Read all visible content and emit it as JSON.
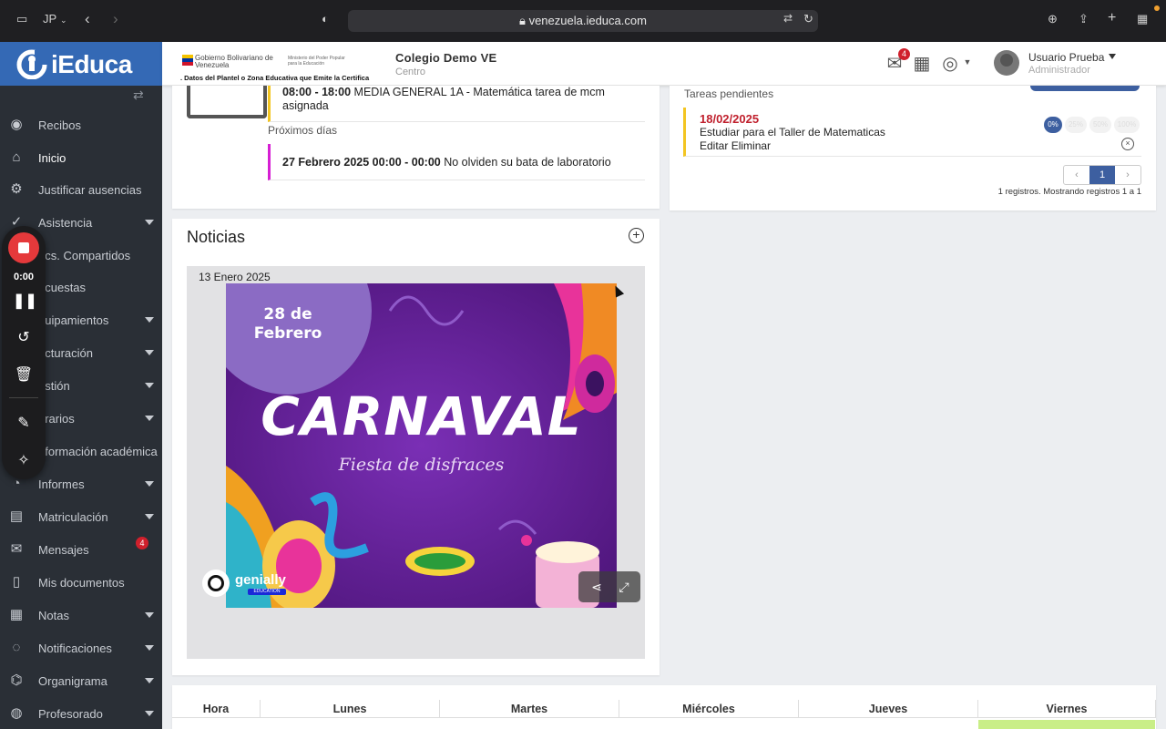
{
  "browser": {
    "profile": "JP",
    "url": "venezuela.ieduca.com"
  },
  "sidebar": {
    "brand": "iEduca",
    "items": [
      {
        "label": "Recibos",
        "icon": "coins-icon",
        "caret": false
      },
      {
        "label": "Inicio",
        "icon": "home-icon",
        "caret": false,
        "active": true
      },
      {
        "label": "Justificar ausencias",
        "icon": "gear-icon",
        "caret": false
      },
      {
        "label": "Asistencia",
        "icon": "check-circle-icon",
        "caret": true
      },
      {
        "label": "ocs. Compartidos",
        "icon": "folder-icon",
        "caret": false
      },
      {
        "label": "ncuestas",
        "icon": "poll-icon",
        "caret": false
      },
      {
        "label": "quipamientos",
        "icon": "box-icon",
        "caret": true
      },
      {
        "label": "acturación",
        "icon": "invoice-icon",
        "caret": true
      },
      {
        "label": "estión",
        "icon": "briefcase-icon",
        "caret": true
      },
      {
        "label": "orarios",
        "icon": "clock-icon",
        "caret": true
      },
      {
        "label": "nformación académica",
        "icon": "graduation-icon",
        "caret": false
      },
      {
        "label": "Informes",
        "icon": "pie-chart-icon",
        "caret": true
      },
      {
        "label": "Matriculación",
        "icon": "id-card-icon",
        "caret": true
      },
      {
        "label": "Mensajes",
        "icon": "envelope-icon",
        "caret": false,
        "badge": "4"
      },
      {
        "label": "Mis documentos",
        "icon": "document-icon",
        "caret": false
      },
      {
        "label": "Notas",
        "icon": "grid-icon",
        "caret": true
      },
      {
        "label": "Notificaciones",
        "icon": "chat-icon",
        "caret": true
      },
      {
        "label": "Organigrama",
        "icon": "sitemap-icon",
        "caret": true
      },
      {
        "label": "Profesorado",
        "icon": "user-icon",
        "caret": true
      }
    ]
  },
  "recorder": {
    "time": "0:00"
  },
  "header": {
    "gov_line1": "Gobierno Bolivariano de Venezuela",
    "gov_line2": "Ministerio del Poder Popular para la Educación",
    "gov_line3": ". Datos del Plantel o Zona Educativa que Emite la Certifica",
    "school_name": "Colegio Demo VE",
    "school_sub": "Centro",
    "mail_badge": "4",
    "user_name": "Usuario Prueba",
    "user_role": "Administrador"
  },
  "events": {
    "today_time": "08:00 - 18:00",
    "today_text": "MEDIA GENERAL 1A - Matemática tarea de mcm asignada",
    "upcoming_label": "Próximos días",
    "upcoming_time": "27 Febrero 2025 00:00 - 00:00",
    "upcoming_text": "No olviden su bata de laboratorio"
  },
  "tasks": {
    "title": "Tareas pendientes",
    "date": "18/02/2025",
    "description": "Estudiar para el Taller de Matematicas",
    "edit": "Editar",
    "delete": "Eliminar",
    "progress_options": [
      "0%",
      "25%",
      "50%",
      "100%"
    ],
    "progress_selected": "0%",
    "page": "1",
    "records_info": "1 registros. Mostrando registros 1 a 1"
  },
  "news": {
    "title": "Noticias",
    "date": "13 Enero 2025",
    "poster_date": "28 de Febrero",
    "poster_title": "CARNAVAL",
    "poster_subtitle": "Fiesta de disfraces",
    "poster_brand": "genially",
    "poster_brand_sub": "EDUCATION"
  },
  "schedule": {
    "columns": [
      "Hora",
      "Lunes",
      "Martes",
      "Miércoles",
      "Jueves",
      "Viernes"
    ]
  },
  "colors": {
    "brand_blue": "#3469b5",
    "sidebar_bg": "#2a2f36",
    "accent_blue": "#3d5fa0",
    "badge_red": "#d0202c",
    "event_yellow": "#f3c521",
    "event_magenta": "#d61fd3",
    "poster_purple": "#5a1d8e"
  }
}
